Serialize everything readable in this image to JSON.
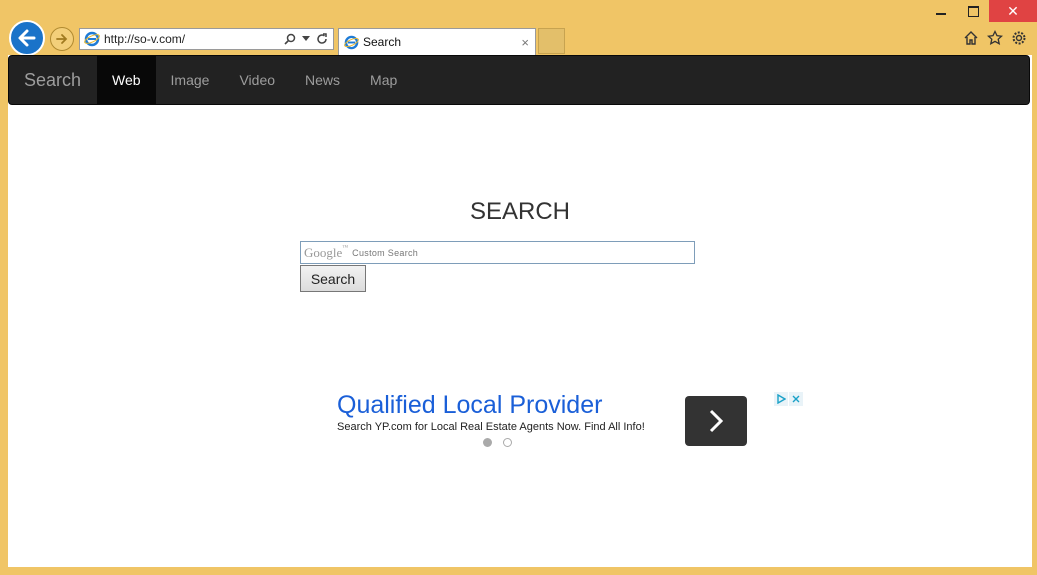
{
  "browser": {
    "url": "http://so-v.com/",
    "tab_label": "Search",
    "tab_close": "×",
    "window_close": "✕"
  },
  "navbar": {
    "brand": "Search",
    "items": [
      {
        "label": "Web",
        "active": true
      },
      {
        "label": "Image",
        "active": false
      },
      {
        "label": "Video",
        "active": false
      },
      {
        "label": "News",
        "active": false
      },
      {
        "label": "Map",
        "active": false
      }
    ]
  },
  "main": {
    "title": "SEARCH",
    "search_logo": "Google",
    "search_logo_tm": "™",
    "search_placeholder": "Custom Search",
    "search_button": "Search"
  },
  "ad": {
    "title": "Qualified Local Provider",
    "description": "Search YP.com for Local Real Estate Agents Now. Find All Info!"
  },
  "colors": {
    "frame": "#f0c566",
    "navbar": "#222222",
    "ad_link": "#1a5fd8",
    "close_button": "#e04343"
  }
}
